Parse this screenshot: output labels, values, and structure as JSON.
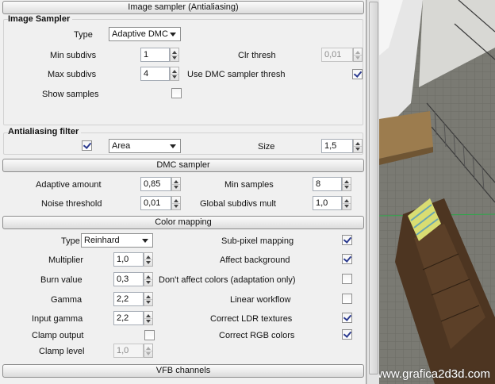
{
  "rollouts": {
    "image_sampler": "Image sampler (Antialiasing)",
    "dmc_sampler": "DMC sampler",
    "color_mapping": "Color mapping",
    "vfb_channels": "VFB channels"
  },
  "image_sampler": {
    "group_title": "Image Sampler",
    "type_label": "Type",
    "type_value": "Adaptive DMC",
    "min_subdivs_label": "Min subdivs",
    "min_subdivs_value": "1",
    "max_subdivs_label": "Max subdivs",
    "max_subdivs_value": "4",
    "show_samples_label": "Show samples",
    "show_samples_checked": false,
    "clr_thresh_label": "Clr thresh",
    "clr_thresh_value": "0,01",
    "use_dmc_label": "Use DMC sampler thresh",
    "use_dmc_checked": true
  },
  "aa_filter": {
    "group_title": "Antialiasing filter",
    "enabled": true,
    "filter_value": "Area",
    "size_label": "Size",
    "size_value": "1,5"
  },
  "dmc_sampler": {
    "adaptive_amount_label": "Adaptive amount",
    "adaptive_amount_value": "0,85",
    "noise_threshold_label": "Noise threshold",
    "noise_threshold_value": "0,01",
    "min_samples_label": "Min samples",
    "min_samples_value": "8",
    "global_subdivs_label": "Global subdivs mult",
    "global_subdivs_value": "1,0"
  },
  "color_mapping": {
    "type_label": "Type",
    "type_value": "Reinhard",
    "multiplier_label": "Multiplier",
    "multiplier_value": "1,0",
    "burn_label": "Burn value",
    "burn_value": "0,3",
    "gamma_label": "Gamma",
    "gamma_value": "2,2",
    "input_gamma_label": "Input gamma",
    "input_gamma_value": "2,2",
    "clamp_output_label": "Clamp output",
    "clamp_output_checked": false,
    "clamp_level_label": "Clamp level",
    "clamp_level_value": "1,0",
    "subpixel_label": "Sub-pixel mapping",
    "subpixel_checked": true,
    "affect_bg_label": "Affect background",
    "affect_bg_checked": true,
    "dont_affect_label": "Don't affect colors (adaptation only)",
    "dont_affect_checked": false,
    "linear_label": "Linear workflow",
    "linear_checked": false,
    "correct_ldr_label": "Correct LDR textures",
    "correct_ldr_checked": true,
    "correct_rgb_label": "Correct RGB colors",
    "correct_rgb_checked": true
  },
  "watermark": "© www.grafica2d3d.com",
  "colors": {
    "panel_bg": "#f0f0f0",
    "check_mark": "#2b3a8f",
    "viewport_floor": "#7d7d76"
  }
}
